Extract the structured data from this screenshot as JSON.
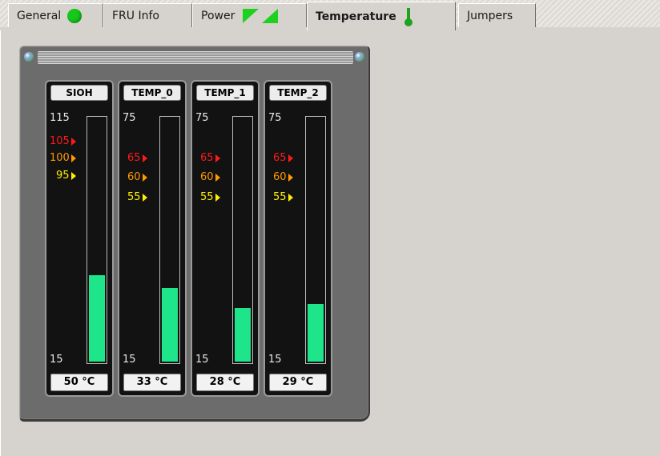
{
  "tabs": [
    {
      "label": "General",
      "icon": "green-status-dot-icon",
      "active": false
    },
    {
      "label": "FRU Info",
      "icon": null,
      "active": false
    },
    {
      "label": "Power",
      "icon": "power-triangles-icon",
      "active": false
    },
    {
      "label": "Temperature",
      "icon": "thermometer-icon",
      "active": true
    },
    {
      "label": "Jumpers",
      "icon": null,
      "active": false
    }
  ],
  "colors": {
    "threshold_critical": "#ff1a1a",
    "threshold_major": "#ff9900",
    "threshold_minor": "#ffee00",
    "fill": "#1ee48a"
  },
  "sensors": [
    {
      "name": "SIOH",
      "max": "115",
      "min": "15",
      "thresholds": [
        "105",
        "100",
        "95"
      ],
      "value": 50,
      "reading": "50 °C"
    },
    {
      "name": "TEMP_0",
      "max": "75",
      "min": "15",
      "thresholds": [
        "65",
        "60",
        "55"
      ],
      "value": 33,
      "reading": "33 °C"
    },
    {
      "name": "TEMP_1",
      "max": "75",
      "min": "15",
      "thresholds": [
        "65",
        "60",
        "55"
      ],
      "value": 28,
      "reading": "28 °C"
    },
    {
      "name": "TEMP_2",
      "max": "75",
      "min": "15",
      "thresholds": [
        "65",
        "60",
        "55"
      ],
      "value": 29,
      "reading": "29 °C"
    }
  ]
}
